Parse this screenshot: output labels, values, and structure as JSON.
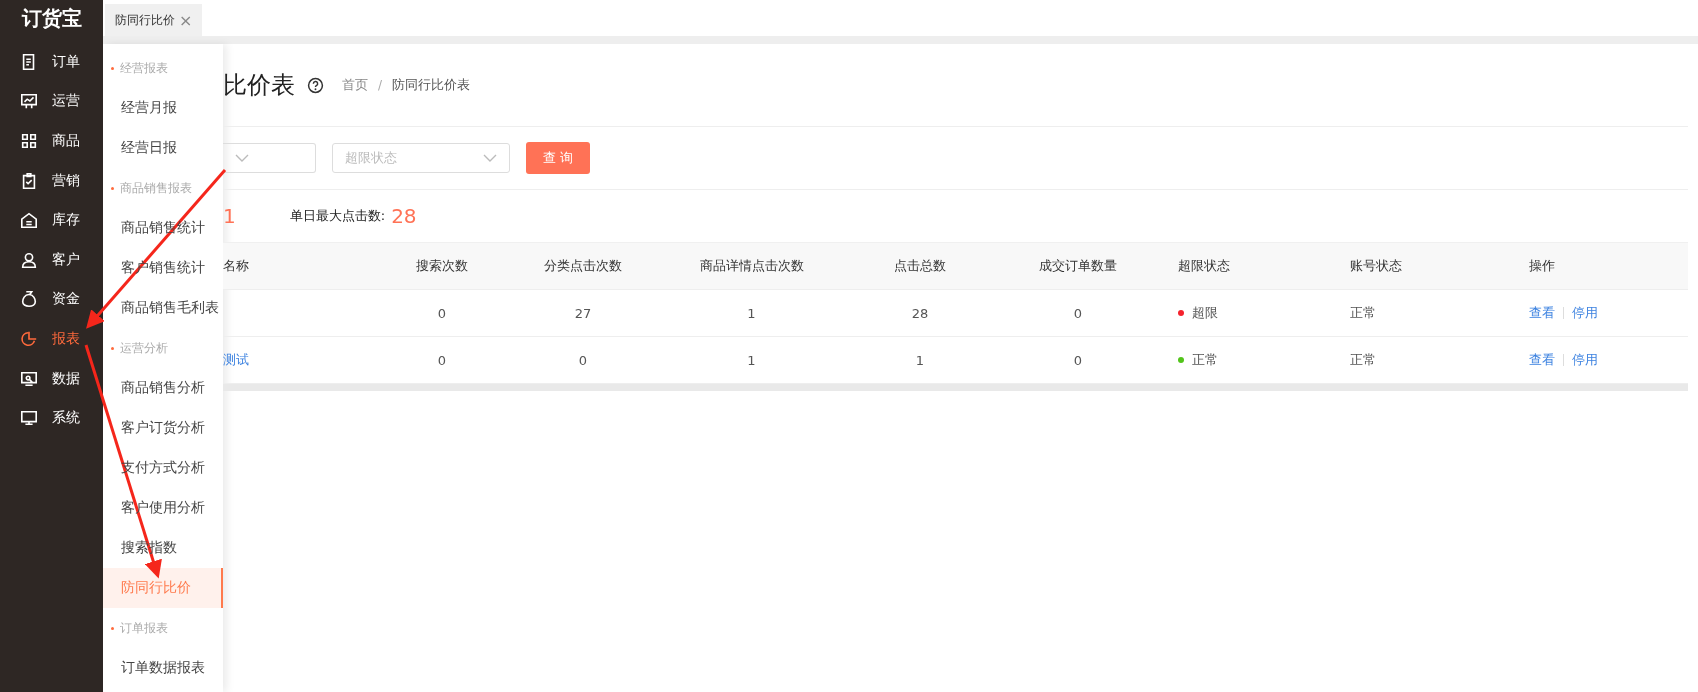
{
  "logo": "订货宝",
  "nav": [
    {
      "label": "订单",
      "selected": false
    },
    {
      "label": "运营",
      "selected": false
    },
    {
      "label": "商品",
      "selected": false
    },
    {
      "label": "营销",
      "selected": false
    },
    {
      "label": "库存",
      "selected": false
    },
    {
      "label": "客户",
      "selected": false
    },
    {
      "label": "资金",
      "selected": false
    },
    {
      "label": "报表",
      "selected": true
    },
    {
      "label": "数据",
      "selected": false
    },
    {
      "label": "系统",
      "selected": false
    }
  ],
  "tabs": [
    {
      "label": "防同行比价",
      "selected": true,
      "close": "×"
    }
  ],
  "submenu": [
    {
      "kind": "group",
      "label": "经营报表"
    },
    {
      "kind": "item",
      "label": "经营月报",
      "selected": false
    },
    {
      "kind": "item",
      "label": "经营日报",
      "selected": false
    },
    {
      "kind": "group",
      "label": "商品销售报表"
    },
    {
      "kind": "item",
      "label": "商品销售统计",
      "selected": false
    },
    {
      "kind": "item",
      "label": "客户销售统计",
      "selected": false
    },
    {
      "kind": "item",
      "label": "商品销售毛利表",
      "selected": false
    },
    {
      "kind": "group",
      "label": "运营分析"
    },
    {
      "kind": "item",
      "label": "商品销售分析",
      "selected": false
    },
    {
      "kind": "item",
      "label": "客户订货分析",
      "selected": false
    },
    {
      "kind": "item",
      "label": "支付方式分析",
      "selected": false
    },
    {
      "kind": "item",
      "label": "客户使用分析",
      "selected": false
    },
    {
      "kind": "item",
      "label": "搜索指数",
      "selected": false
    },
    {
      "kind": "item",
      "label": "防同行比价",
      "selected": true
    },
    {
      "kind": "group",
      "label": "订单报表"
    },
    {
      "kind": "item",
      "label": "订单数据报表",
      "selected": false
    }
  ],
  "page_title": "比价表",
  "breadcrumb": [
    "首页",
    "防同行比价表"
  ],
  "breadcrumb_separator": "/",
  "filters": [
    {
      "placeholder": "超限状态"
    }
  ],
  "query_button": "查 询",
  "stats": [
    {
      "value": "1"
    },
    {
      "label": "单日最大点击数:",
      "value": "28"
    }
  ],
  "table": {
    "columns": [
      {
        "label": "名称"
      },
      {
        "label": "搜索次数"
      },
      {
        "label": "分类点击次数"
      },
      {
        "label": "商品详情点击次数"
      },
      {
        "label": "点击总数"
      },
      {
        "label": "成交订单数量"
      },
      {
        "label": "超限状态"
      },
      {
        "label": "账号状态"
      },
      {
        "label": "操作"
      }
    ],
    "rows": [
      {
        "search": "0",
        "category_clicks": "27",
        "detail_clicks": "1",
        "total_clicks": "28",
        "orders": "0",
        "limit_status": {
          "label": "超限",
          "color": "#f5222d"
        },
        "account_status": "正常",
        "actions": [
          "查看",
          "停用"
        ]
      },
      {
        "name": "测试",
        "search": "0",
        "category_clicks": "0",
        "detail_clicks": "1",
        "total_clicks": "1",
        "orders": "0",
        "limit_status": {
          "label": "正常",
          "color": "#52c41a"
        },
        "account_status": "正常",
        "actions": [
          "查看",
          "停用"
        ]
      }
    ]
  }
}
